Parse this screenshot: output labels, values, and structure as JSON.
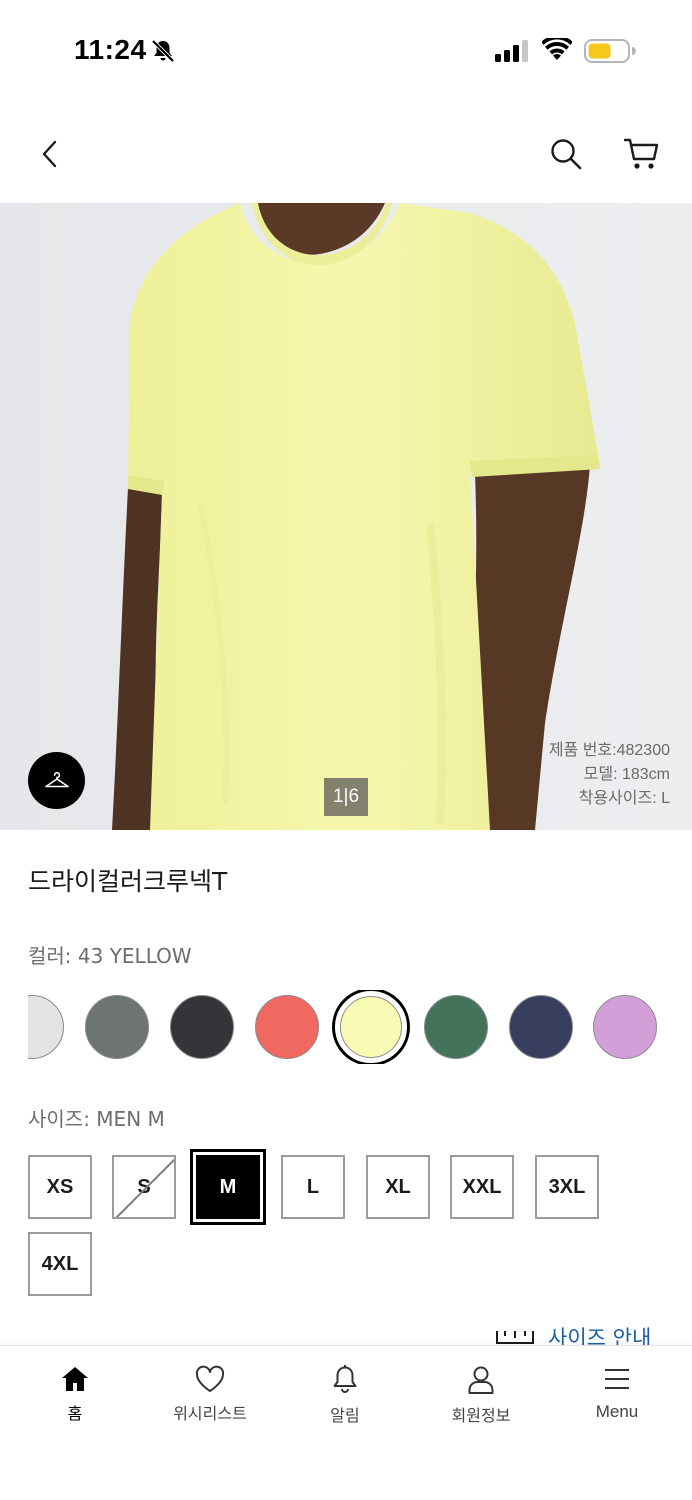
{
  "status_bar": {
    "time": "11:24"
  },
  "product": {
    "name": "드라이컬러크루넥T",
    "image_page": "1|6",
    "model_info": {
      "product_number": "제품 번호:482300",
      "model_height": "모델: 183cm",
      "wearing_size": "착용사이즈: L"
    },
    "color_label": "컬러: 43 YELLOW",
    "colors": [
      "#e3e3e3",
      "#6e7473",
      "#333538",
      "#f0685f",
      "#f8fbb3",
      "#44735c",
      "#383e5d",
      "#d39fd8"
    ],
    "selected_color_index": 4,
    "size_label": "사이즈: MEN M",
    "sizes": [
      "XS",
      "S",
      "M",
      "L",
      "XL",
      "XXL",
      "3XL",
      "4XL"
    ],
    "selected_size": "M",
    "unavailable_size": "S",
    "size_guide_label": "사이즈 안내"
  },
  "tab_bar": {
    "tabs": [
      {
        "label": "홈",
        "icon": "home-icon"
      },
      {
        "label": "위시리스트",
        "icon": "heart-icon"
      },
      {
        "label": "알림",
        "icon": "bell-icon"
      },
      {
        "label": "회원정보",
        "icon": "user-icon"
      },
      {
        "label": "Menu",
        "icon": "menu-icon"
      }
    ]
  },
  "colors": {
    "link": "#1a5fa8",
    "shirt": "#f3f4a4"
  }
}
